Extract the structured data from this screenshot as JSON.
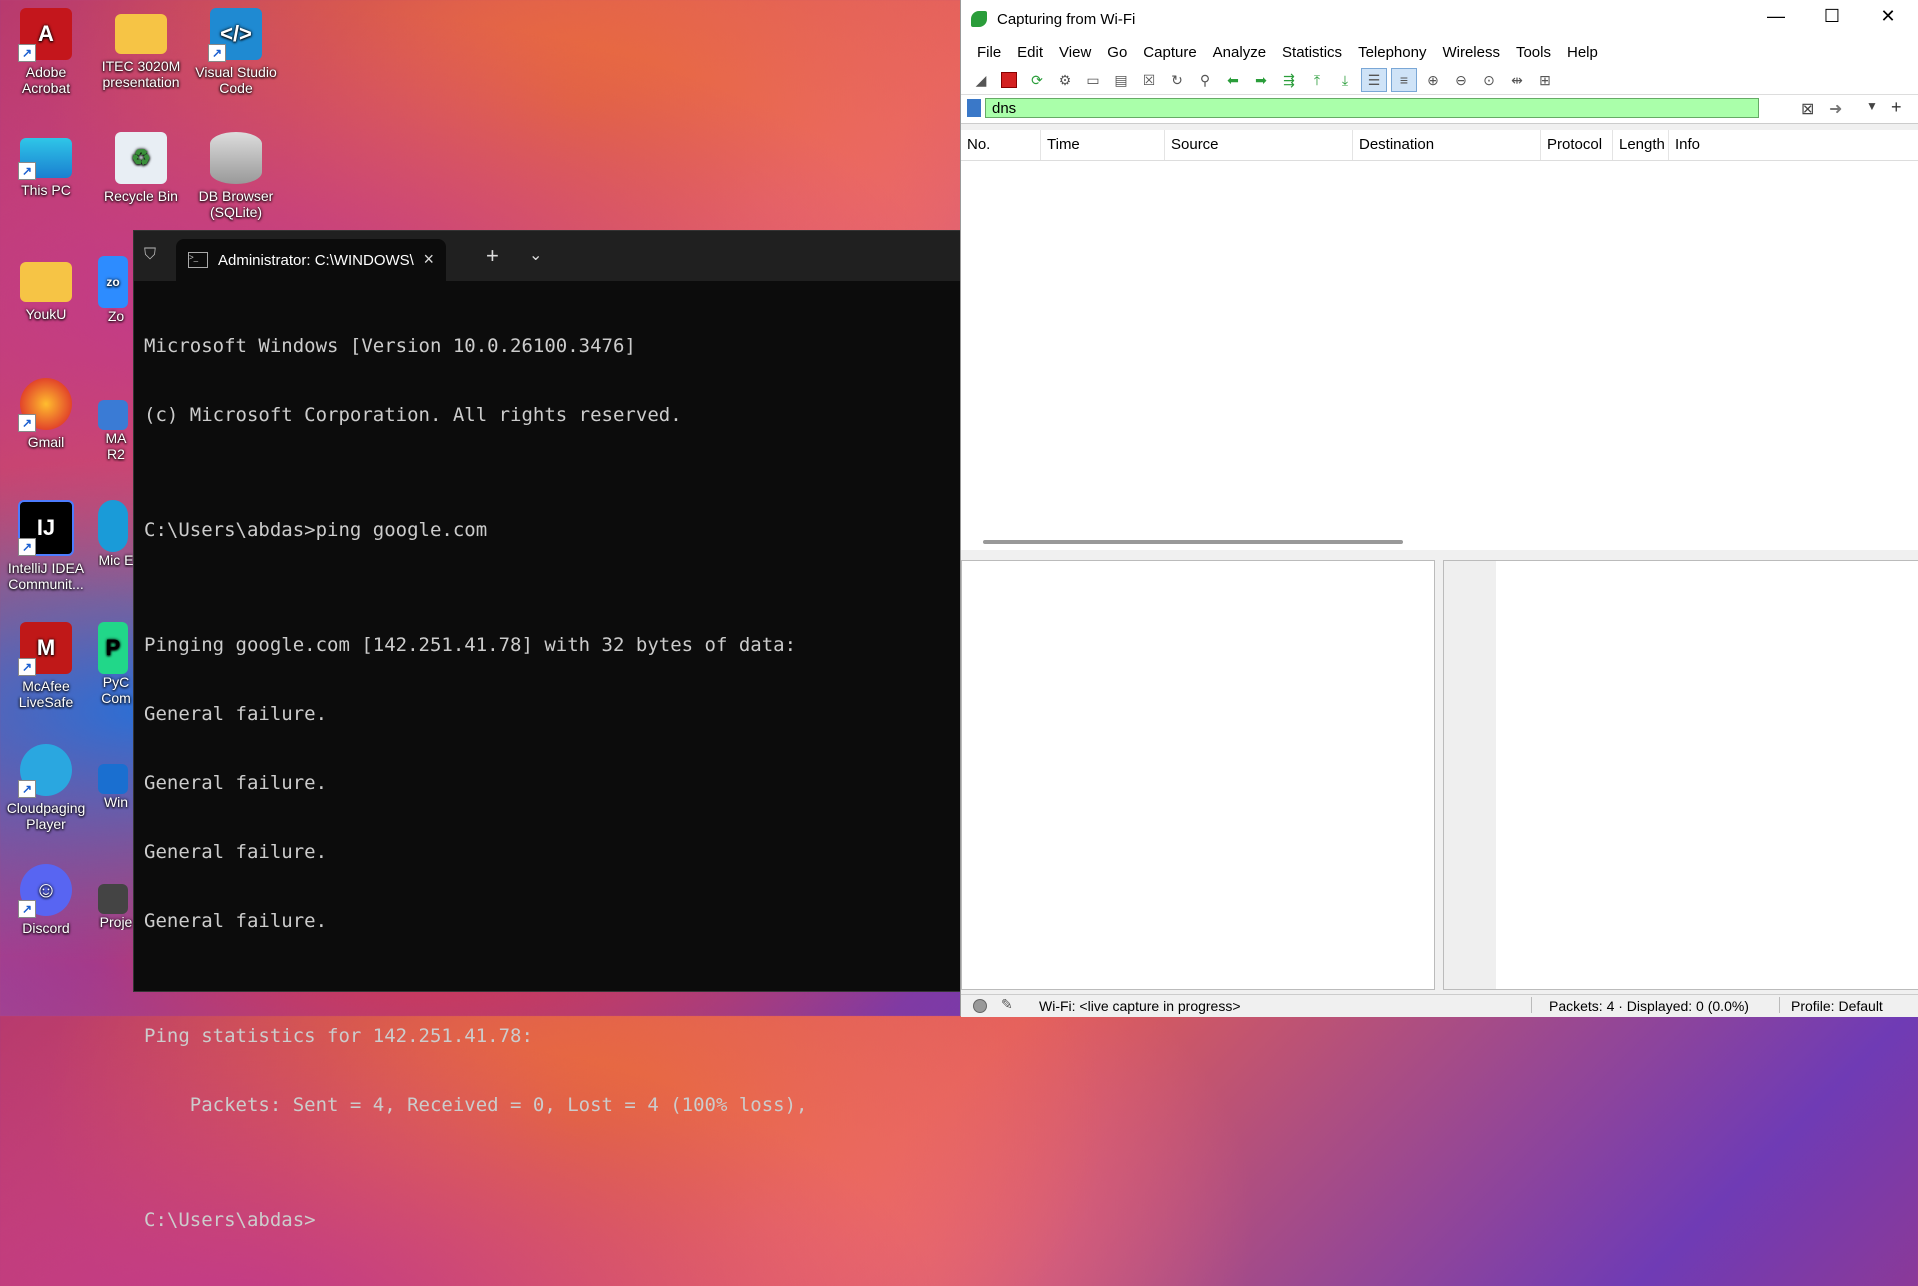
{
  "desktop": {
    "icons": [
      {
        "label": "Adobe Acrobat"
      },
      {
        "label": "ITEC 3020M presentation"
      },
      {
        "label": "Visual Studio Code"
      },
      {
        "label": "This PC"
      },
      {
        "label": "Recycle Bin"
      },
      {
        "label": "DB Browser (SQLite)"
      },
      {
        "label": "YoukU"
      },
      {
        "label": "Zo"
      },
      {
        "label": "Gmail"
      },
      {
        "label": "MA R2"
      },
      {
        "label": "IntelliJ IDEA Communit..."
      },
      {
        "label": "Mic E"
      },
      {
        "label": "McAfee LiveSafe"
      },
      {
        "label": "PyC Com"
      },
      {
        "label": "Cloudpaging Player"
      },
      {
        "label": "Win"
      },
      {
        "label": "Discord"
      },
      {
        "label": "Proje"
      }
    ]
  },
  "terminal": {
    "tab_title": "Administrator: C:\\WINDOWS\\",
    "lines": [
      "Microsoft Windows [Version 10.0.26100.3476]",
      "(c) Microsoft Corporation. All rights reserved.",
      "",
      "C:\\Users\\abdas>ping google.com",
      "",
      "Pinging google.com [142.251.41.78] with 32 bytes of data:",
      "General failure.",
      "General failure.",
      "General failure.",
      "General failure.",
      "",
      "Ping statistics for 142.251.41.78:",
      "    Packets: Sent = 4, Received = 0, Lost = 4 (100% loss),",
      "",
      "C:\\Users\\abdas>"
    ]
  },
  "wireshark": {
    "title": "Capturing from Wi-Fi",
    "menu": [
      "File",
      "Edit",
      "View",
      "Go",
      "Capture",
      "Analyze",
      "Statistics",
      "Telephony",
      "Wireless",
      "Tools",
      "Help"
    ],
    "filter_value": "dns",
    "columns": [
      "No.",
      "Time",
      "Source",
      "Destination",
      "Protocol",
      "Length",
      "Info"
    ],
    "status": {
      "interface": "Wi-Fi: <live capture in progress>",
      "packets": "Packets: 4 · Displayed: 0 (0.0%)",
      "profile": "Profile: Default"
    }
  },
  "colors": {
    "filter_valid": "#aaffaa",
    "terminal_bg": "#0c0c0c",
    "stop_red": "#d32020"
  }
}
